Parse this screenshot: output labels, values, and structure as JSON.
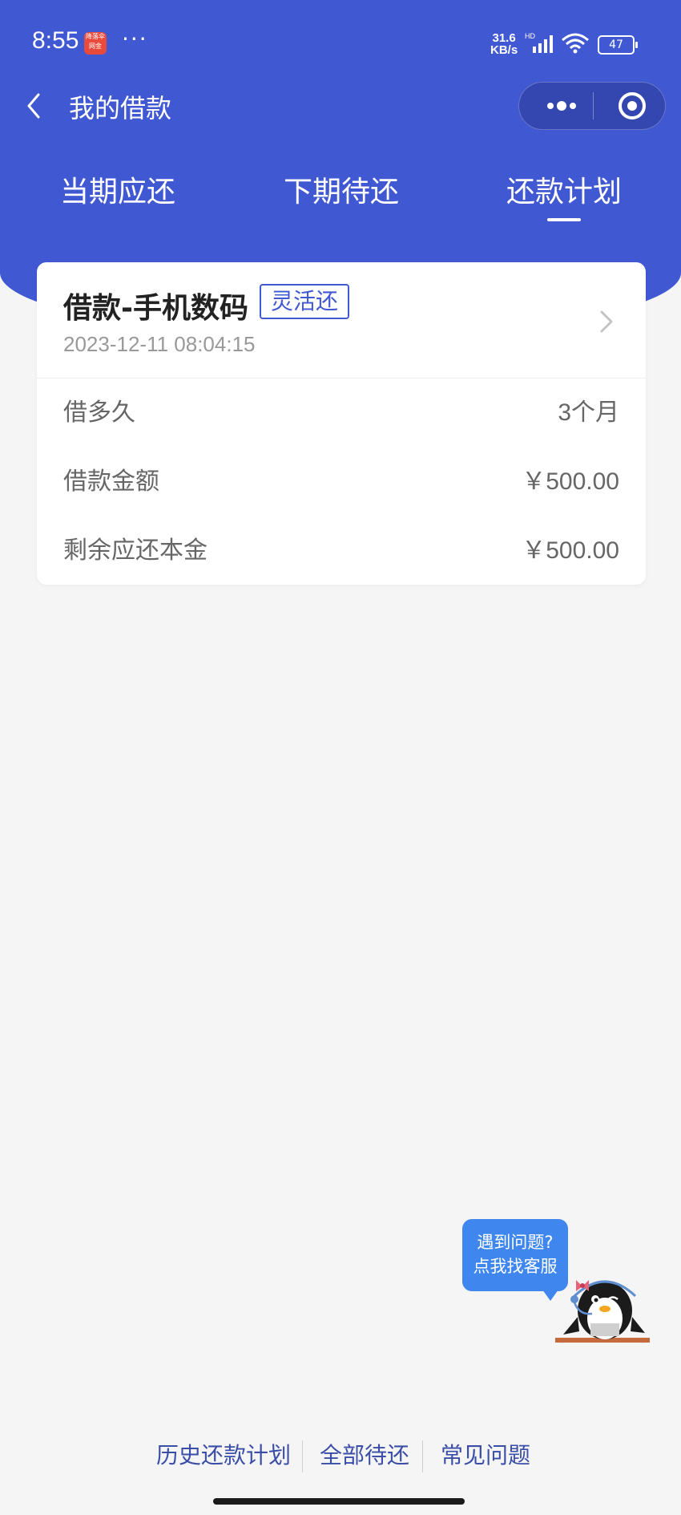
{
  "status_bar": {
    "time": "8:55",
    "app_icon_label": "降落伞 网金",
    "dots": "···",
    "speed_value": "31.6",
    "speed_unit": "KB/s",
    "network": "HD",
    "battery": "47"
  },
  "nav": {
    "title": "我的借款"
  },
  "tabs": [
    {
      "label": "当期应还",
      "active": false
    },
    {
      "label": "下期待还",
      "active": false
    },
    {
      "label": "还款计划",
      "active": true
    }
  ],
  "loan_card": {
    "title": "借款-手机数码",
    "tag": "灵活还",
    "date": "2023-12-11 08:04:15",
    "rows": [
      {
        "label": "借多久",
        "value": "3个月"
      },
      {
        "label": "借款金额",
        "value": "￥500.00"
      },
      {
        "label": "剩余应还本金",
        "value": "￥500.00"
      }
    ]
  },
  "support": {
    "line1": "遇到问题?",
    "line2": "点我找客服"
  },
  "footer": {
    "links": [
      "历史还款计划",
      "全部待还",
      "常见问题"
    ]
  },
  "colors": {
    "primary": "#4158d3",
    "background": "#f5f5f5",
    "link": "#3a4ea7",
    "bubble": "#3f87ef"
  }
}
